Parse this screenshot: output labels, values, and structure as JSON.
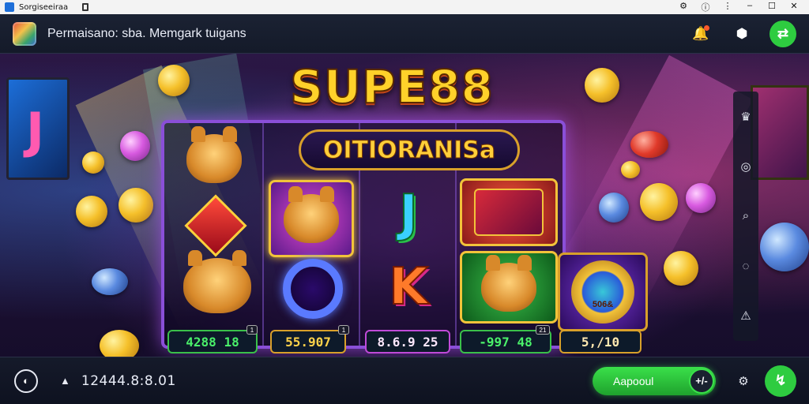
{
  "os_bar": {
    "title": "Sorgiseeiraa",
    "controls": [
      "⚙",
      "ⓘ",
      "⋮",
      "–",
      "☐",
      "✕"
    ]
  },
  "header": {
    "title": "Permaisano: sba. Memgark tuigans",
    "icons": [
      "notification-icon",
      "location-icon",
      "shuffle-icon"
    ],
    "glyphs": {
      "notification": "🔔",
      "location": "⬢",
      "shuffle": "⇄"
    }
  },
  "game": {
    "logo": "SUPE88",
    "sub_logo": "OITIORANISa",
    "value_plates": [
      "4288 18",
      "55.907",
      "8.6.9 25",
      "-997 48",
      "5,/10"
    ],
    "badges": [
      "1",
      "1",
      "21"
    ],
    "reel_letters": {
      "j": "J",
      "k": "K"
    },
    "medal_text": "506&"
  },
  "rail": {
    "icons": [
      "crown-icon",
      "camera-icon",
      "search-icon",
      "chat-icon",
      "alert-icon"
    ],
    "glyphs": [
      "♛",
      "◎",
      "⌕",
      "◌",
      "⚠"
    ]
  },
  "bottom": {
    "balance": "12444.8:8.01",
    "action_label": "Aapooul",
    "knob_glyph": "+/-",
    "logo_glyph": "◐",
    "arrow_glyph": "▲",
    "settings_glyph": "⚙",
    "green_glyph": "↯"
  }
}
